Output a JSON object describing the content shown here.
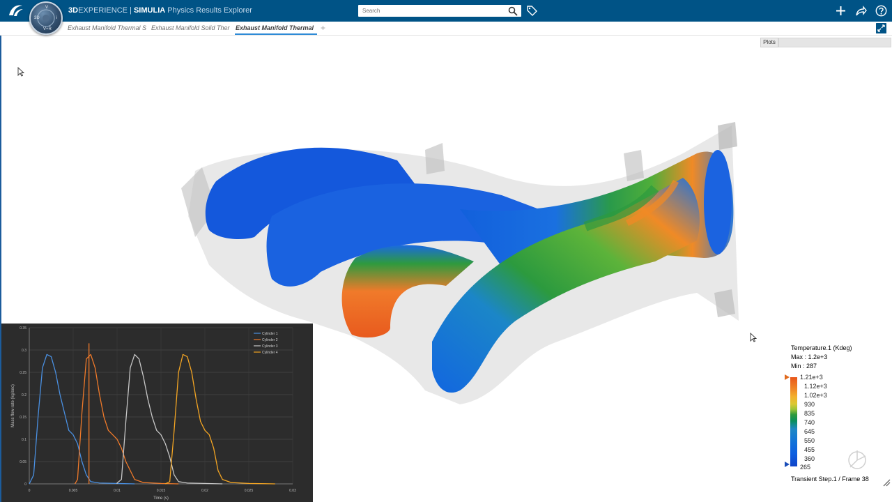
{
  "header": {
    "brand_bold": "3D",
    "brand_exp": "EXPERIENCE",
    "separator": "|",
    "brand_app": "SIMULIA",
    "app_name": "Physics Results Explorer",
    "search_placeholder": "Search",
    "compass_labels": [
      "3D",
      "V",
      "i",
      "V+R"
    ]
  },
  "tabs": [
    {
      "label": "Exhaust Manifold Thermal S",
      "active": false
    },
    {
      "label": "Exhaust Manifold Solid Ther",
      "active": false
    },
    {
      "label": "Exhaust Manifold Thermal",
      "active": true
    }
  ],
  "toolbar": {
    "plots_label": "Plots"
  },
  "legend": {
    "title": "Temperature.1 (Kdeg)",
    "max": "Max : 1.2e+3",
    "min": "Min : 287",
    "ticks": [
      "1.21e+3",
      "1.12e+3",
      "1.02e+3",
      "930",
      "835",
      "740",
      "645",
      "550",
      "455",
      "360",
      "265"
    ],
    "footer": "Transient Step.1 / Frame 38"
  },
  "chart_data": {
    "type": "line",
    "xlabel": "Time (s)",
    "ylabel": "Mass flow rate (kg/sec)",
    "xlim": [
      0,
      0.03
    ],
    "ylim": [
      0,
      0.35
    ],
    "x_ticks": [
      "0",
      "0.005",
      "0.01",
      "0.015",
      "0.02",
      "0.025",
      "0.03"
    ],
    "y_ticks": [
      "0",
      "0.05",
      "0.1",
      "0.15",
      "0.2",
      "0.25",
      "0.3",
      "0.35"
    ],
    "legend_position": "top-right",
    "series": [
      {
        "name": "Cylinder 1",
        "color": "#4a90e2",
        "x": [
          0,
          0.0005,
          0.001,
          0.0015,
          0.002,
          0.0025,
          0.003,
          0.0035,
          0.004,
          0.0045,
          0.005,
          0.0055,
          0.006,
          0.0065,
          0.007,
          0.008,
          0.01,
          0.012
        ],
        "y": [
          0,
          0.02,
          0.15,
          0.26,
          0.29,
          0.285,
          0.25,
          0.2,
          0.16,
          0.12,
          0.11,
          0.09,
          0.05,
          0.02,
          0.005,
          0.002,
          0.001,
          0
        ]
      },
      {
        "name": "Cylinder 2",
        "color": "#f07a2a",
        "x": [
          0.0052,
          0.0055,
          0.006,
          0.0065,
          0.007,
          0.0075,
          0.008,
          0.0085,
          0.009,
          0.0095,
          0.01,
          0.0105,
          0.011,
          0.012,
          0.013,
          0.015,
          0.017
        ],
        "y": [
          0,
          0.01,
          0.16,
          0.28,
          0.29,
          0.26,
          0.2,
          0.15,
          0.12,
          0.11,
          0.1,
          0.08,
          0.05,
          0.01,
          0.003,
          0.001,
          0
        ]
      },
      {
        "name": "Cylinder 3",
        "color": "#c8c8c8",
        "x": [
          0.01,
          0.01,
          0.0105,
          0.011,
          0.0115,
          0.012,
          0.0125,
          0.013,
          0.0135,
          0.014,
          0.0145,
          0.015,
          0.0155,
          0.016,
          0.0165,
          0.017,
          0.018,
          0.02,
          0.022
        ],
        "y": [
          0,
          0.002,
          0.01,
          0.14,
          0.26,
          0.29,
          0.28,
          0.24,
          0.19,
          0.15,
          0.12,
          0.11,
          0.09,
          0.06,
          0.02,
          0.005,
          0.002,
          0.001,
          0
        ]
      },
      {
        "name": "Cylinder 4",
        "color": "#f5a623",
        "x": [
          0.0155,
          0.016,
          0.0165,
          0.017,
          0.0175,
          0.018,
          0.0185,
          0.019,
          0.0195,
          0.02,
          0.0205,
          0.021,
          0.0215,
          0.022,
          0.023,
          0.025,
          0.028
        ],
        "y": [
          0,
          0.005,
          0.12,
          0.25,
          0.29,
          0.285,
          0.25,
          0.19,
          0.14,
          0.12,
          0.11,
          0.08,
          0.03,
          0.01,
          0.003,
          0.001,
          0
        ]
      },
      {
        "name": "",
        "color": "#f07a2a",
        "x": [
          0.0068,
          0.0068
        ],
        "y": [
          0,
          0.315
        ]
      }
    ]
  }
}
